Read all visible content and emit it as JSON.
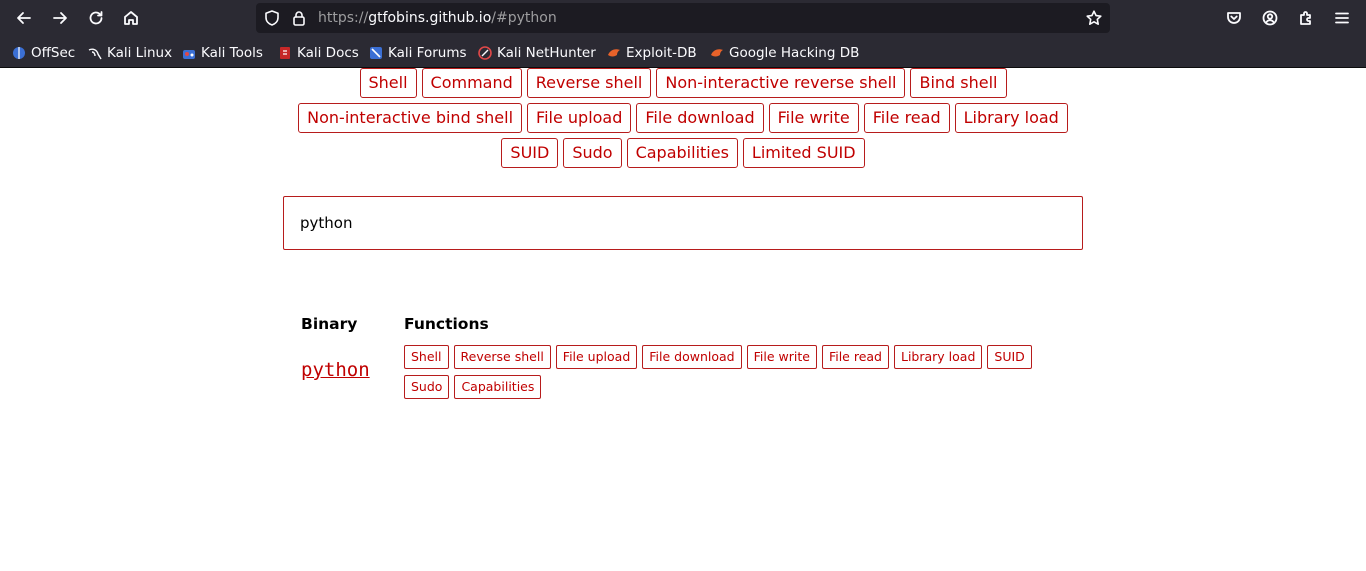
{
  "browser": {
    "url_prefix": "https://",
    "url_host": "gtfobins.github.io",
    "url_path": "/#python",
    "colors": {
      "chrome": "#2b2a33",
      "urlbar": "#1c1b22"
    }
  },
  "bookmarks": [
    {
      "label": "OffSec",
      "icon": "offsec-icon"
    },
    {
      "label": "Kali Linux",
      "icon": "kali-dragon-icon"
    },
    {
      "label": "Kali Tools",
      "icon": "kali-tools-icon"
    },
    {
      "label": "Kali Docs",
      "icon": "kali-docs-icon"
    },
    {
      "label": "Kali Forums",
      "icon": "kali-forums-icon"
    },
    {
      "label": "Kali NetHunter",
      "icon": "nethunter-icon"
    },
    {
      "label": "Exploit-DB",
      "icon": "exploitdb-icon"
    },
    {
      "label": "Google Hacking DB",
      "icon": "ghdb-icon"
    }
  ],
  "filters": {
    "row1": [
      "Shell",
      "Command",
      "Reverse shell",
      "Non-interactive reverse shell",
      "Bind shell"
    ],
    "row2": [
      "Non-interactive bind shell",
      "File upload",
      "File download",
      "File write",
      "File read",
      "Library load"
    ],
    "row3": [
      "SUID",
      "Sudo",
      "Capabilities",
      "Limited SUID"
    ]
  },
  "search": {
    "value": "python"
  },
  "results": {
    "header_binary": "Binary",
    "header_functions": "Functions",
    "rows": [
      {
        "binary": "python",
        "functions": [
          "Shell",
          "Reverse shell",
          "File upload",
          "File download",
          "File write",
          "File read",
          "Library load",
          "SUID",
          "Sudo",
          "Capabilities"
        ]
      }
    ]
  },
  "accent_color": "#c00000"
}
